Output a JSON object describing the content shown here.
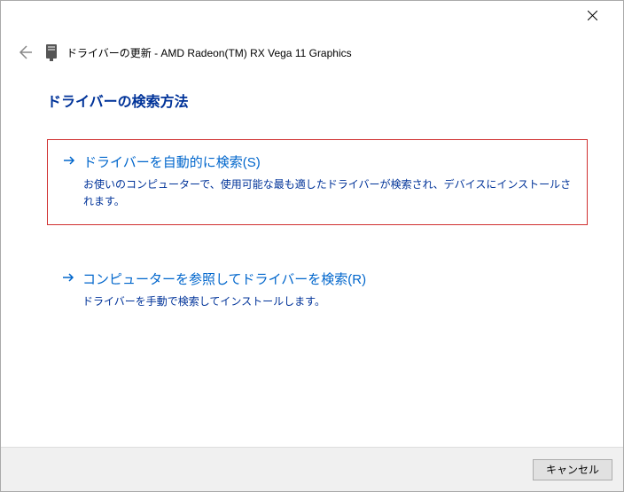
{
  "header": {
    "title": "ドライバーの更新 - AMD Radeon(TM) RX Vega 11 Graphics"
  },
  "main": {
    "heading": "ドライバーの検索方法",
    "options": [
      {
        "title": "ドライバーを自動的に検索(S)",
        "description": "お使いのコンピューターで、使用可能な最も適したドライバーが検索され、デバイスにインストールされます。"
      },
      {
        "title": "コンピューターを参照してドライバーを検索(R)",
        "description": "ドライバーを手動で検索してインストールします。"
      }
    ]
  },
  "footer": {
    "cancel_label": "キャンセル"
  }
}
